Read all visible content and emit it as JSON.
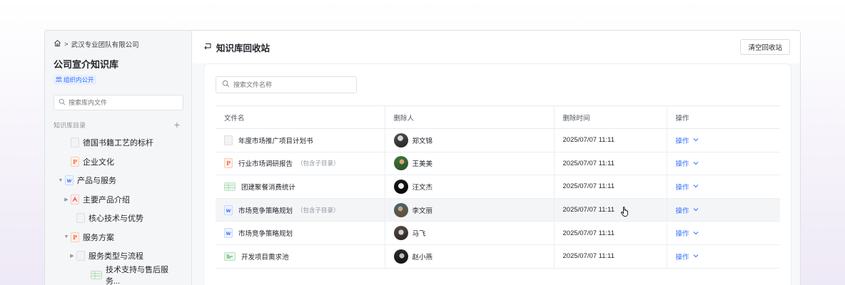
{
  "sidebar": {
    "breadcrumb": {
      "separator": ">",
      "org": "武汉专业团队有限公司"
    },
    "kb_title": "公司宣介知识库",
    "visibility": "组织内公开",
    "search_placeholder": "搜索库内文件",
    "tree_header": "知识库目录",
    "tree": [
      {
        "label": "德国书籍工艺的标杆",
        "icon": "doc-icon",
        "level": 1,
        "caret": ""
      },
      {
        "label": "企业文化",
        "icon": "ppt-icon",
        "level": 1,
        "caret": ""
      },
      {
        "label": "产品与服务",
        "icon": "word-icon",
        "level": 0,
        "caret": "▼"
      },
      {
        "label": "主要产品介绍",
        "icon": "pdf-icon",
        "level": 1,
        "caret": "▶"
      },
      {
        "label": "核心技术与优势",
        "icon": "doc-icon",
        "level": 2,
        "caret": ""
      },
      {
        "label": "服务方案",
        "icon": "ppt-icon",
        "level": 1,
        "caret": "▼"
      },
      {
        "label": "服务类型与流程",
        "icon": "doc-icon",
        "level": 2,
        "caret": "▶"
      },
      {
        "label": "技术支持与售后服务...",
        "icon": "sheet-icon",
        "level": 3,
        "caret": ""
      }
    ]
  },
  "main": {
    "title": "知识库回收站",
    "clear_button": "清空回收站",
    "search_placeholder": "搜索文件名称",
    "columns": [
      "文件名",
      "删除人",
      "删除时间",
      "操作"
    ],
    "rows": [
      {
        "name": "年度市场推广项目计划书",
        "tag": "",
        "icon": "doc-icon",
        "user": "郑文锦",
        "time": "2025/07/07 11:11",
        "action": "操作"
      },
      {
        "name": "行业市场调研报告",
        "tag": "（包含子目录）",
        "icon": "ppt-icon",
        "user": "王美美",
        "time": "2025/07/07 11:11",
        "action": "操作"
      },
      {
        "name": "团建聚餐消费统计",
        "tag": "",
        "icon": "sheet-icon",
        "user": "汪文杰",
        "time": "2025/07/07 11:11",
        "action": "操作"
      },
      {
        "name": "市场竞争策略规划",
        "tag": "（包含子目录）",
        "icon": "word-icon",
        "user": "李文丽",
        "time": "2025/07/07 11:11",
        "action": "操作"
      },
      {
        "name": "市场竞争策略规划",
        "tag": "",
        "icon": "word-icon",
        "user": "马飞",
        "time": "2025/07/07 11:11",
        "action": "操作"
      },
      {
        "name": "开发项目需求池",
        "tag": "",
        "icon": "board-icon",
        "user": "赵小燕",
        "time": "2025/07/07 11:11",
        "action": "操作"
      }
    ],
    "hover_row": 3
  },
  "colors": {
    "accent": "#3370ff",
    "ppt": "#f06a3c",
    "sheet": "#34a853"
  }
}
